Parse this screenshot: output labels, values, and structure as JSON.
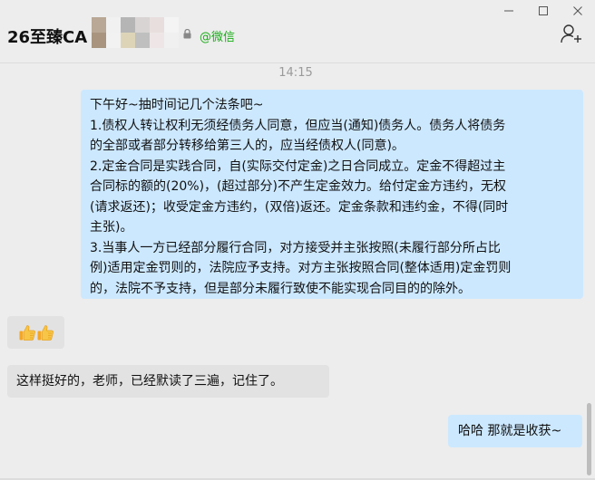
{
  "header": {
    "title": "26至臻CA",
    "source_tag": "@微信",
    "accent_color": "#1aad19",
    "add_icon": "add-member-icon"
  },
  "window": {
    "controls": [
      "minimize-icon",
      "maximize-icon",
      "close-icon"
    ]
  },
  "chat": {
    "timestamp": "14:15",
    "messages": [
      {
        "side": "right",
        "lines": [
          "下午好~抽时间记几个法条吧~",
          "1.债权人转让权利无须经债务人同意，但应当(通知)债务人。债务人将债务",
          "的全部或者部分转移给第三人的，应当经债权人(同意)。",
          "2.定金合同是实践合同，自(实际交付定金)之日合同成立。定金不得超过主",
          "合同标的额的(20%)，(超过部分)不产生定金效力。给付定金方违约，无权",
          "(请求返还)；收受定金方违约，(双倍)返还。定金条款和违约金，不得(同时",
          "主张)。",
          "3.当事人一方已经部分履行合同，对方接受并主张按照(未履行部分所占比",
          "例)适用定金罚则的，法院应予支持。对方主张按照合同(整体适用)定金罚则",
          "的，法院不予支持，但是部分未履行致使不能实现合同目的的除外。"
        ]
      },
      {
        "side": "left",
        "emoji": [
          "thumbs-up-icon",
          "thumbs-up-icon"
        ]
      },
      {
        "side": "left",
        "text": "这样挺好的，老师，已经默读了三遍，记住了。"
      },
      {
        "side": "right",
        "text": "哈哈 那就是收获~"
      }
    ]
  }
}
